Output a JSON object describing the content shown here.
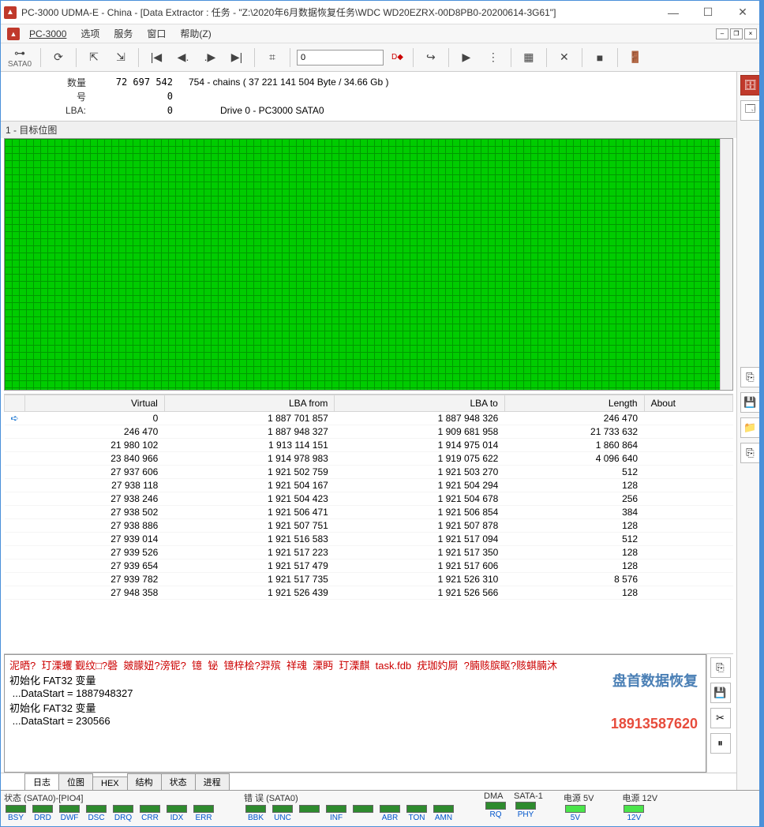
{
  "titlebar": {
    "text": "PC-3000 UDMA-E - China - [Data Extractor : 任务 - \"Z:\\2020年6月数据恢复任务\\WDC WD20EZRX-00D8PB0-20200614-3G61\"]"
  },
  "menubar": {
    "brand": "PC-3000",
    "items": [
      "选项",
      "服务",
      "窗口",
      "帮助(Z)"
    ]
  },
  "toolbar": {
    "sata_label": "SATA0",
    "input_value": "0",
    "input_marker": "D◆"
  },
  "info": {
    "rows": [
      {
        "label": "数量",
        "value": "72 697 542",
        "extra": "754 - chains  ( 37 221 141 504 Byte /  34.66 Gb )"
      },
      {
        "label": "号",
        "value": "0",
        "extra": ""
      },
      {
        "label": "LBA:",
        "value": "0",
        "extra": "Drive     0 - PC3000 SATA0"
      }
    ]
  },
  "bitmap_title": "1 - 目标位图",
  "table": {
    "headers": [
      "",
      "Virtual",
      "LBA from",
      "LBA to",
      "Length",
      "About"
    ],
    "rows": [
      {
        "icon": "➪",
        "virtual": "0",
        "from": "1 887 701 857",
        "to": "1 887 948 326",
        "len": "246 470",
        "about": ""
      },
      {
        "icon": "",
        "virtual": "246 470",
        "from": "1 887 948 327",
        "to": "1 909 681 958",
        "len": "21 733 632",
        "about": ""
      },
      {
        "icon": "",
        "virtual": "21 980 102",
        "from": "1 913 114 151",
        "to": "1 914 975 014",
        "len": "1 860 864",
        "about": ""
      },
      {
        "icon": "",
        "virtual": "23 840 966",
        "from": "1 914 978 983",
        "to": "1 919 075 622",
        "len": "4 096 640",
        "about": ""
      },
      {
        "icon": "",
        "virtual": "27 937 606",
        "from": "1 921 502 759",
        "to": "1 921 503 270",
        "len": "512",
        "about": ""
      },
      {
        "icon": "",
        "virtual": "27 938 118",
        "from": "1 921 504 167",
        "to": "1 921 504 294",
        "len": "128",
        "about": ""
      },
      {
        "icon": "",
        "virtual": "27 938 246",
        "from": "1 921 504 423",
        "to": "1 921 504 678",
        "len": "256",
        "about": ""
      },
      {
        "icon": "",
        "virtual": "27 938 502",
        "from": "1 921 506 471",
        "to": "1 921 506 854",
        "len": "384",
        "about": ""
      },
      {
        "icon": "",
        "virtual": "27 938 886",
        "from": "1 921 507 751",
        "to": "1 921 507 878",
        "len": "128",
        "about": ""
      },
      {
        "icon": "",
        "virtual": "27 939 014",
        "from": "1 921 516 583",
        "to": "1 921 517 094",
        "len": "512",
        "about": ""
      },
      {
        "icon": "",
        "virtual": "27 939 526",
        "from": "1 921 517 223",
        "to": "1 921 517 350",
        "len": "128",
        "about": ""
      },
      {
        "icon": "",
        "virtual": "27 939 654",
        "from": "1 921 517 479",
        "to": "1 921 517 606",
        "len": "128",
        "about": ""
      },
      {
        "icon": "",
        "virtual": "27 939 782",
        "from": "1 921 517 735",
        "to": "1 921 526 310",
        "len": "8 576",
        "about": ""
      },
      {
        "icon": "",
        "virtual": "27 948 358",
        "from": "1 921 526 439",
        "to": "1 921 526 566",
        "len": "128",
        "about": ""
      }
    ]
  },
  "log": {
    "line1": "泥晒?  玎溧蠼 觐纹□?磬  皴朦妞?滂铌?  镱  铋  镱梓桧?羿殡  祥魂  溧眄  玎溧麒  task.fdb  疣珈妁屙  ?腩赅膑眍?赅蜞腩沐",
    "line2": "初始化 FAT32 变量\n ...DataStart = 1887948327\n初始化 FAT32 变量\n ...DataStart = 230566",
    "watermark_title": "盘首数据恢复",
    "watermark_phone": "18913587620"
  },
  "tabs": [
    "日志",
    "位图",
    "HEX",
    "结构",
    "状态",
    "进程"
  ],
  "status": {
    "g1_title": "状态 (SATA0)-[PIO4]",
    "g1_leds": [
      "BSY",
      "DRD",
      "DWF",
      "DSC",
      "DRQ",
      "CRR",
      "IDX",
      "ERR"
    ],
    "g2_title": "错 误 (SATA0)",
    "g2_leds": [
      "BBK",
      "UNC",
      "",
      "INF",
      "",
      "ABR",
      "TON",
      "AMN"
    ],
    "g3_title": "DMA",
    "g3_leds": [
      "RQ"
    ],
    "g4_title": "SATA-1",
    "g4_leds": [
      "PHY"
    ],
    "g5_title": "电源 5V",
    "g5_leds": [
      "5V"
    ],
    "g6_title": "电源 12V",
    "g6_leds": [
      "12V"
    ]
  }
}
